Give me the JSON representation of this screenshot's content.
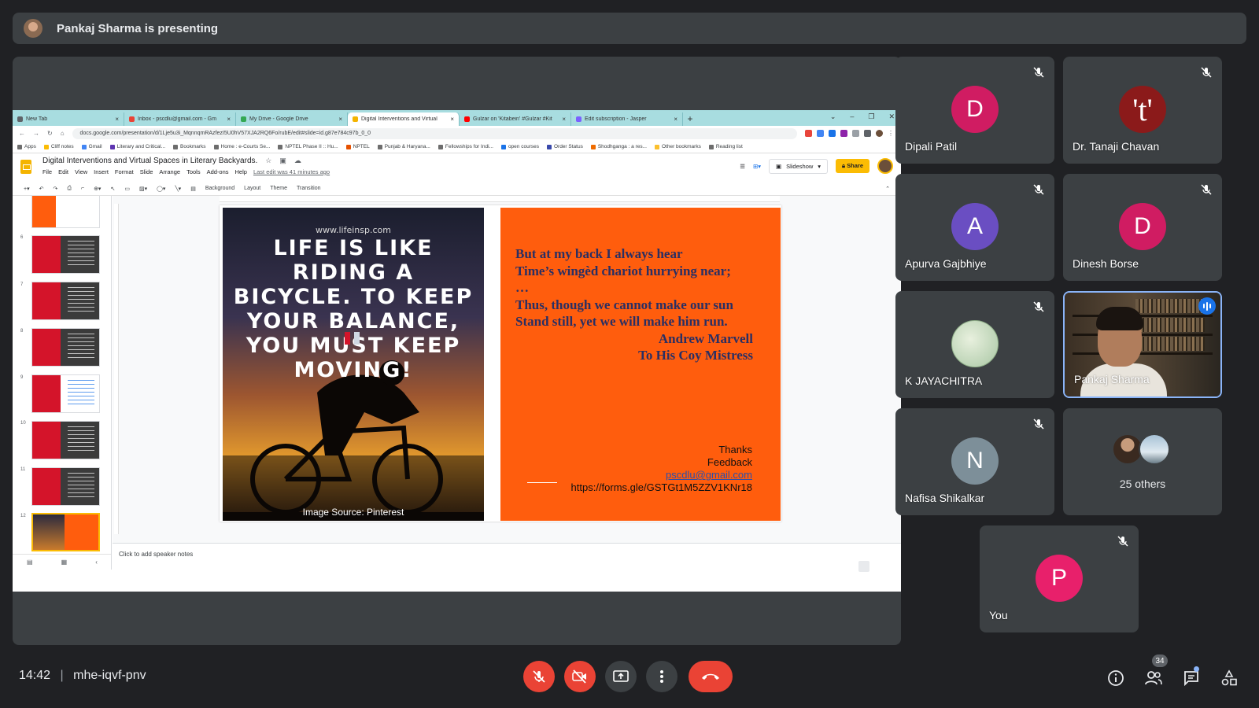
{
  "banner": {
    "presenter_text": "Pankaj Sharma is presenting"
  },
  "browser": {
    "tabs": [
      {
        "label": "New Tab",
        "color": "#5f6368"
      },
      {
        "label": "Inbox - pscdlu@gmail.com - Gm",
        "color": "#ea4335"
      },
      {
        "label": "My Drive - Google Drive",
        "color": "#34a853"
      },
      {
        "label": "Digital Interventions and Virtual",
        "color": "#f4b400"
      },
      {
        "label": "Gulzar on 'Kitabein' #Gulzar #Kit",
        "color": "#ff0000"
      },
      {
        "label": "Edit subscription - Jasper",
        "color": "#7b61ff"
      }
    ],
    "url": "docs.google.com/presentation/d/1Lje5u3i_MqnnqmRAzfezI5U0hV57XJA2RQ6Fo/rubE/edit#slide=id.g87e784c97b_0_0",
    "bookmarks": [
      "Apps",
      "Cliff notes",
      "Gmail",
      "Literary and Critical...",
      "Bookmarks",
      "Home : e-Courts Se...",
      "NPTEL Phase II :: Hu...",
      "NPTEL",
      "Punjab & Haryana...",
      "Fellowships for Indi...",
      "open courses",
      "Order Status",
      "Shodhganga : a res...",
      "Other bookmarks",
      "Reading list"
    ]
  },
  "slides_app": {
    "title": "Digital Interventions and Virtual Spaces in Literary Backyards.",
    "menus": [
      "File",
      "Edit",
      "View",
      "Insert",
      "Format",
      "Slide",
      "Arrange",
      "Tools",
      "Add-ons",
      "Help"
    ],
    "last_edit": "Last edit was 41 minutes ago",
    "slideshow_label": "Slideshow",
    "share_label": "Share",
    "toolbar": [
      "Background",
      "Layout",
      "Theme",
      "Transition"
    ],
    "thumb_numbers": [
      "6",
      "7",
      "8",
      "9",
      "10",
      "11",
      "12"
    ],
    "speaker_notes": "Click to add speaker notes"
  },
  "slide": {
    "url_text": "www.lifeinsp.com",
    "quote": "LIFE IS LIKE RIDING A BICYCLE. TO KEEP YOUR BALANCE, YOU MUST KEEP MOVING!",
    "image_source": "Image Source: Pinterest",
    "poem": [
      "But at my back I always hear",
      "Time’s wingèd chariot hurrying near;",
      "…",
      "Thus, though we cannot make our sun",
      "Stand still, yet we will make him run."
    ],
    "author": "Andrew Marvell",
    "work": "To His Coy Mistress",
    "thanks": "Thanks",
    "feedback": "Feedback",
    "email": "pscdlu@gmail.com",
    "form_link": "https://forms.gle/GSTGt1M5ZZV1KNr18"
  },
  "participants": [
    {
      "initial": "D",
      "name": "Dipali Patil",
      "color": "#d01c62"
    },
    {
      "initial": "'t'",
      "name": "Dr. Tanaji Chavan",
      "color": "#8b1a1a"
    },
    {
      "initial": "A",
      "name": "Apurva Gajbhiye",
      "color": "#6a4ec2"
    },
    {
      "initial": "D",
      "name": "Dinesh Borse",
      "color": "#d01c62"
    },
    {
      "initial": "",
      "name": "K JAYACHITRA",
      "color": "#c7dfc6"
    },
    {
      "initial": "",
      "name": "Pankaj Sharma",
      "color": "#3a2f24"
    },
    {
      "initial": "N",
      "name": "Nafisa Shikalkar",
      "color": "#7d8f99"
    },
    {
      "initial": "",
      "name": "25 others",
      "color": "#3c4043"
    },
    {
      "initial": "P",
      "name": "You",
      "color": "#e8206b"
    }
  ],
  "bottom_bar": {
    "time": "14:42",
    "meeting_code": "mhe-iqvf-pnv",
    "participant_count": "34"
  }
}
